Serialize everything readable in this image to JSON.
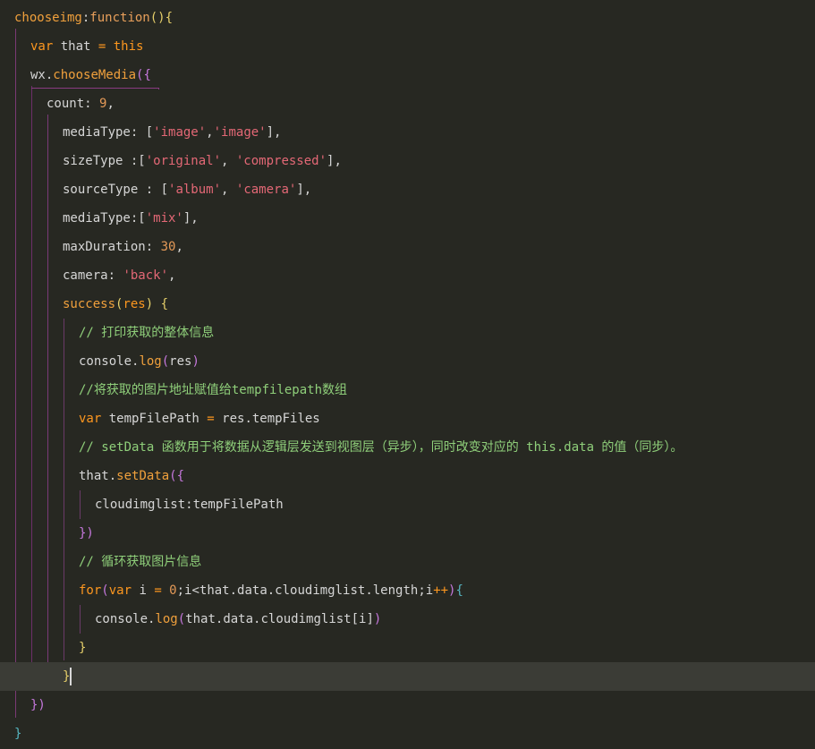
{
  "editor": {
    "lines": [
      {
        "id": "l1",
        "parts": [
          [
            "chooseimg",
            "k-sel"
          ],
          [
            ":",
            ""
          ],
          [
            "function",
            "k-func"
          ],
          [
            "()",
            "k-paren1"
          ],
          [
            "{",
            "k-paren1"
          ]
        ]
      },
      {
        "id": "l2",
        "parts": [
          [
            "var ",
            "k-orange"
          ],
          [
            "that ",
            ""
          ],
          [
            "= ",
            "k-orange"
          ],
          [
            "this",
            "k-orange"
          ]
        ]
      },
      {
        "id": "l3",
        "parts": [
          [
            "wx.",
            ""
          ],
          [
            "chooseMedia",
            "k-sel"
          ],
          [
            "({",
            "k-paren2"
          ]
        ]
      },
      {
        "id": "l4",
        "parts": [
          [
            "count: ",
            ""
          ],
          [
            "9",
            "k-num"
          ],
          [
            ",",
            ""
          ]
        ]
      },
      {
        "id": "l5",
        "parts": [
          [
            "mediaType: [",
            ""
          ],
          [
            "'image'",
            "k-str"
          ],
          [
            ",",
            ""
          ],
          [
            "'image'",
            "k-str"
          ],
          [
            "],",
            ""
          ]
        ]
      },
      {
        "id": "l6",
        "parts": [
          [
            "sizeType :[",
            ""
          ],
          [
            "'original'",
            "k-str"
          ],
          [
            ", ",
            ""
          ],
          [
            "'compressed'",
            "k-str"
          ],
          [
            "],",
            ""
          ]
        ]
      },
      {
        "id": "l7",
        "parts": [
          [
            "sourceType : [",
            ""
          ],
          [
            "'album'",
            "k-str"
          ],
          [
            ", ",
            ""
          ],
          [
            "'camera'",
            "k-str"
          ],
          [
            "],",
            ""
          ]
        ]
      },
      {
        "id": "l8",
        "parts": [
          [
            "mediaType:[",
            ""
          ],
          [
            "'mix'",
            "k-str"
          ],
          [
            "],",
            ""
          ]
        ]
      },
      {
        "id": "l9",
        "parts": [
          [
            "maxDuration: ",
            ""
          ],
          [
            "30",
            "k-num"
          ],
          [
            ",",
            ""
          ]
        ]
      },
      {
        "id": "l10",
        "parts": [
          [
            "camera: ",
            ""
          ],
          [
            "'back'",
            "k-str"
          ],
          [
            ",",
            ""
          ]
        ]
      },
      {
        "id": "l11",
        "parts": [
          [
            "success",
            "k-sel"
          ],
          [
            "(",
            "k-paren1"
          ],
          [
            "res",
            "k-orange"
          ],
          [
            ") ",
            "k-paren1"
          ],
          [
            "{",
            "k-paren1"
          ]
        ]
      },
      {
        "id": "l12",
        "parts": [
          [
            "// 打印获取的整体信息",
            "k-comment"
          ]
        ]
      },
      {
        "id": "l13",
        "parts": [
          [
            "console.",
            ""
          ],
          [
            "log",
            "k-sel"
          ],
          [
            "(",
            "k-paren2"
          ],
          [
            "res",
            ""
          ],
          [
            ")",
            "k-paren2"
          ]
        ]
      },
      {
        "id": "l14",
        "parts": [
          [
            "//将获取的图片地址赋值给tempfilepath数组",
            "k-comment"
          ]
        ]
      },
      {
        "id": "l15",
        "parts": [
          [
            "var ",
            "k-orange"
          ],
          [
            "tempFilePath ",
            ""
          ],
          [
            "= ",
            "k-orange"
          ],
          [
            "res.tempFiles",
            ""
          ]
        ]
      },
      {
        "id": "l16",
        "parts": [
          [
            "// setData 函数用于将数据从逻辑层发送到视图层（异步），同时改变对应的 this.data 的值（同步）。",
            "k-comment"
          ]
        ]
      },
      {
        "id": "l17",
        "parts": [
          [
            "that.",
            ""
          ],
          [
            "setData",
            "k-sel"
          ],
          [
            "({",
            "k-paren2"
          ]
        ]
      },
      {
        "id": "l18",
        "parts": [
          [
            "cloudimglist:tempFilePath",
            ""
          ]
        ]
      },
      {
        "id": "l19",
        "parts": [
          [
            "})",
            "k-paren2"
          ]
        ]
      },
      {
        "id": "l20",
        "parts": [
          [
            "// 循环获取图片信息",
            "k-comment"
          ]
        ]
      },
      {
        "id": "l21",
        "parts": [
          [
            "for",
            "k-orange"
          ],
          [
            "(",
            "k-paren2"
          ],
          [
            "var ",
            "k-orange"
          ],
          [
            "i ",
            ""
          ],
          [
            "= ",
            "k-orange"
          ],
          [
            "0",
            "k-num"
          ],
          [
            ";i<that.data.cloudimglist.length;i",
            ""
          ],
          [
            "++",
            "k-orange"
          ],
          [
            ")",
            "k-paren2"
          ],
          [
            "{",
            "k-paren3"
          ]
        ]
      },
      {
        "id": "l22",
        "parts": [
          [
            "console.",
            ""
          ],
          [
            "log",
            "k-sel"
          ],
          [
            "(",
            "k-paren2"
          ],
          [
            "that.data.cloudimglist[i]",
            ""
          ],
          [
            ")",
            "k-paren2"
          ]
        ]
      },
      {
        "id": "l23",
        "parts": [
          [
            "}",
            "k-paren1"
          ]
        ]
      },
      {
        "id": "l24",
        "parts": [
          [
            "}",
            "k-paren1"
          ]
        ]
      },
      {
        "id": "l25",
        "parts": [
          [
            "})",
            "k-paren2"
          ]
        ]
      },
      {
        "id": "l26",
        "parts": [
          [
            "}",
            "k-paren3"
          ]
        ]
      }
    ]
  }
}
